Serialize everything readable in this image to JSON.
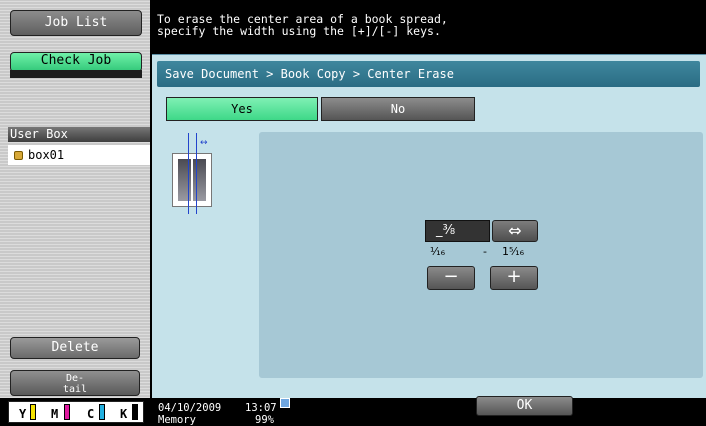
{
  "left_panel": {
    "job_list_label": "Job List",
    "check_job_label": "Check Job",
    "user_box_title": "User Box",
    "user_box_item": "box01",
    "delete_label": "Delete",
    "detail_label_line1": "De-",
    "detail_label_line2": "tail",
    "toner": {
      "Y": {
        "label": "Y",
        "color": "#f4e200"
      },
      "M": {
        "label": "M",
        "color": "#e01aa0"
      },
      "C": {
        "label": "C",
        "color": "#22b0e0"
      },
      "K": {
        "label": "K",
        "color": "#000000"
      }
    }
  },
  "message": {
    "line1": "To erase the center area of a book spread,",
    "line2": "specify the width using the [+]/[-] keys."
  },
  "breadcrumb": "Save Document > Book Copy > Center Erase",
  "toggle": {
    "yes_label": "Yes",
    "no_label": "No",
    "selected": "Yes"
  },
  "width_setting": {
    "value": "_⅜",
    "min": "⅟₁₆",
    "separator": "-",
    "max": "1⁵⁄₁₆",
    "swap_symbol": "⇔",
    "minus_symbol": "−",
    "plus_symbol": "+"
  },
  "status": {
    "date": "04/10/2009",
    "time": "13:07",
    "memory_label": "Memory",
    "memory_value": "99%"
  },
  "ok_label": "OK",
  "colors": {
    "accent_green": "#3ed888",
    "header_teal": "#2a6c84",
    "panel_bg": "#c5e2ea",
    "inner_bg": "#a6c8d5"
  }
}
